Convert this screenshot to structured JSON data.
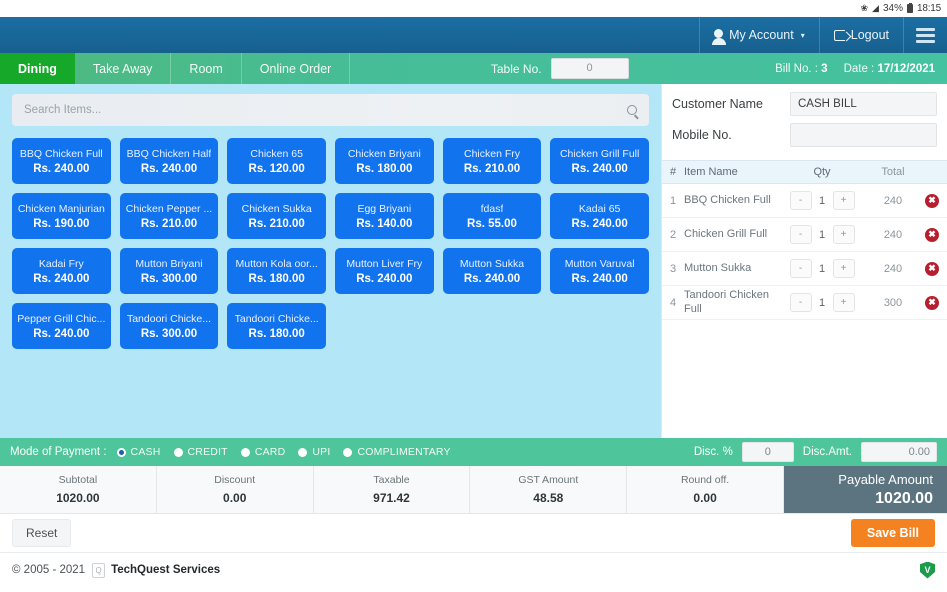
{
  "statusbar": {
    "bluetooth_icon": "bluetooth-icon",
    "wifi_icon": "wifi-icon",
    "battery_percent": "34%",
    "battery_icon": "battery-icon",
    "time": "18:15"
  },
  "navbar": {
    "account_label": "My Account",
    "account_caret": "▾",
    "logout_label": "Logout",
    "menu_icon": "hamburger-menu-icon"
  },
  "tabs": [
    {
      "label": "Dining",
      "active": true
    },
    {
      "label": "Take Away",
      "active": false
    },
    {
      "label": "Room",
      "active": false
    },
    {
      "label": "Online Order",
      "active": false
    }
  ],
  "order_header": {
    "table_no_label": "Table No.",
    "table_no_value": "0",
    "bill_no_label": "Bill No. :",
    "bill_no_value": "3",
    "date_label": "Date :",
    "date_value": "17/12/2021"
  },
  "search": {
    "placeholder": "Search Items...",
    "value": "",
    "icon": "search-icon"
  },
  "menu_items": [
    {
      "name": "BBQ Chicken Full",
      "price": "Rs. 240.00"
    },
    {
      "name": "BBQ Chicken Half",
      "price": "Rs. 240.00"
    },
    {
      "name": "Chicken 65",
      "price": "Rs. 120.00"
    },
    {
      "name": "Chicken Briyani",
      "price": "Rs. 180.00"
    },
    {
      "name": "Chicken Fry",
      "price": "Rs. 210.00"
    },
    {
      "name": "Chicken Grill Full",
      "price": "Rs. 240.00"
    },
    {
      "name": "Chicken Manjurian",
      "price": "Rs. 190.00"
    },
    {
      "name": "Chicken Pepper ...",
      "price": "Rs. 210.00"
    },
    {
      "name": "Chicken Sukka",
      "price": "Rs. 210.00"
    },
    {
      "name": "Egg Briyani",
      "price": "Rs. 140.00"
    },
    {
      "name": "fdasf",
      "price": "Rs. 55.00"
    },
    {
      "name": "Kadai 65",
      "price": "Rs. 240.00"
    },
    {
      "name": "Kadai Fry",
      "price": "Rs. 240.00"
    },
    {
      "name": "Mutton Briyani",
      "price": "Rs. 300.00"
    },
    {
      "name": "Mutton Kola oor...",
      "price": "Rs. 180.00"
    },
    {
      "name": "Mutton Liver Fry",
      "price": "Rs. 240.00"
    },
    {
      "name": "Mutton Sukka",
      "price": "Rs. 240.00"
    },
    {
      "name": "Mutton Varuval",
      "price": "Rs. 240.00"
    },
    {
      "name": "Pepper Grill Chic...",
      "price": "Rs. 240.00"
    },
    {
      "name": "Tandoori Chicke...",
      "price": "Rs. 300.00"
    },
    {
      "name": "Tandoori Chicke...",
      "price": "Rs. 180.00"
    }
  ],
  "customer": {
    "name_label": "Customer Name",
    "name_value": "CASH BILL",
    "mobile_label": "Mobile No.",
    "mobile_value": ""
  },
  "order_table": {
    "columns": [
      "#",
      "Item Name",
      "Qty",
      "Total",
      ""
    ],
    "rows": [
      {
        "idx": "1",
        "item": "BBQ Chicken Full",
        "minus": "-",
        "qty": "1",
        "plus": "+",
        "total": "240",
        "delete_icon": "delete-icon"
      },
      {
        "idx": "2",
        "item": "Chicken Grill Full",
        "minus": "-",
        "qty": "1",
        "plus": "+",
        "total": "240",
        "delete_icon": "delete-icon"
      },
      {
        "idx": "3",
        "item": "Mutton Sukka",
        "minus": "-",
        "qty": "1",
        "plus": "+",
        "total": "240",
        "delete_icon": "delete-icon"
      },
      {
        "idx": "4",
        "item": "Tandoori Chicken Full",
        "minus": "-",
        "qty": "1",
        "plus": "+",
        "total": "300",
        "delete_icon": "delete-icon"
      }
    ]
  },
  "payment": {
    "label": "Mode of Payment  :",
    "options": [
      {
        "label": "CASH",
        "selected": true
      },
      {
        "label": "CREDIT",
        "selected": false
      },
      {
        "label": "CARD",
        "selected": false
      },
      {
        "label": "UPI",
        "selected": false
      },
      {
        "label": "COMPLIMENTARY",
        "selected": false
      }
    ],
    "disc_pct_label": "Disc. %",
    "disc_pct_value": "0",
    "disc_amt_label": "Disc.Amt.",
    "disc_amt_value": "0.00"
  },
  "totals": [
    {
      "label": "Subtotal",
      "value": "1020.00"
    },
    {
      "label": "Discount",
      "value": "0.00"
    },
    {
      "label": "Taxable",
      "value": "971.42"
    },
    {
      "label": "GST Amount",
      "value": "48.58"
    },
    {
      "label": "Round off.",
      "value": "0.00"
    }
  ],
  "payable": {
    "label": "Payable Amount",
    "value": "1020.00"
  },
  "actions": {
    "reset_label": "Reset",
    "save_label": "Save Bill"
  },
  "footer": {
    "copyright": "© 2005 - 2021",
    "favicon": "favicon-icon",
    "brand": "TechQuest Services",
    "logo": "v-shield-logo"
  },
  "colors": {
    "navbar_blue": "#17608f",
    "tab_green": "#46bd96",
    "active_tab_green": "#16a828",
    "tile_blue": "#1273ef",
    "panel_bg": "#b3e7f7",
    "payable_slate": "#5b7480",
    "save_orange": "#f58220",
    "delete_red": "#b81f2e"
  }
}
